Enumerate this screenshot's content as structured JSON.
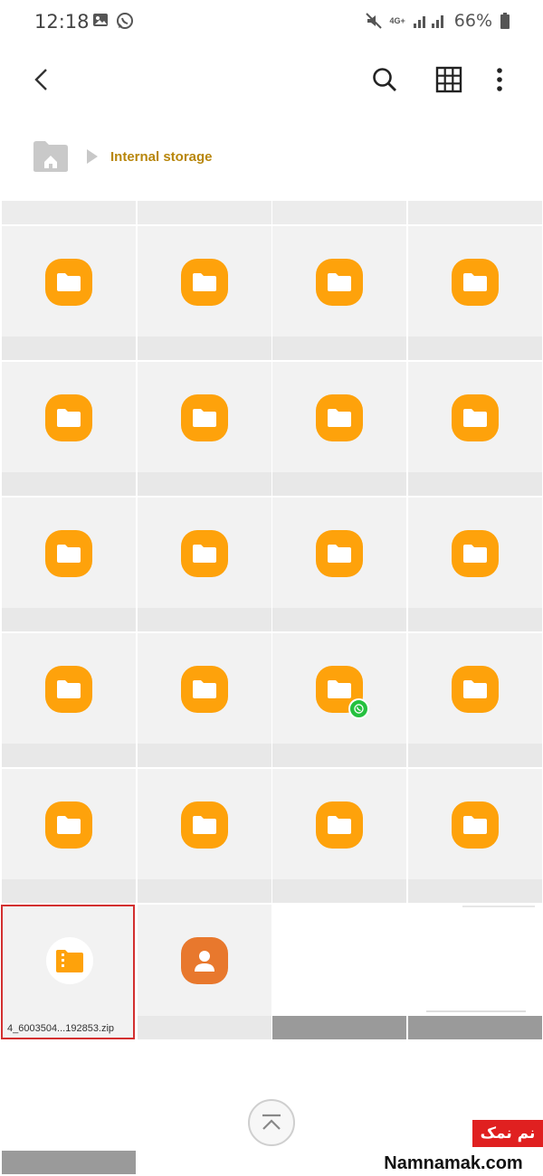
{
  "status_bar": {
    "time": "12:18",
    "network_label": "4G+",
    "battery_percent": "66%",
    "left_icons": [
      "gallery-icon",
      "whatsapp-icon"
    ],
    "right_icons": [
      "mute-icon",
      "signal-icon",
      "battery-icon"
    ]
  },
  "toolbar": {
    "icons": [
      "back-icon",
      "search-icon",
      "grid-view-icon",
      "more-icon"
    ]
  },
  "breadcrumb": {
    "home_icon": "home-folder-icon",
    "location": "Internal storage"
  },
  "grid": {
    "folder_count": 20,
    "whatsapp_folder_index": 14,
    "zip_file_name": "4_6003504...192853.zip",
    "contact_icon": "contact-icon"
  },
  "scroll_top_icon": "scroll-to-top-icon",
  "watermark": {
    "brand": "نم نمک",
    "url": "Namnamak.com"
  },
  "colors": {
    "folder": "#fea20b",
    "contact": "#e8782d",
    "breadcrumb_text": "#b8860b",
    "selection_border": "#d32f2f",
    "whatsapp": "#25c13f"
  }
}
